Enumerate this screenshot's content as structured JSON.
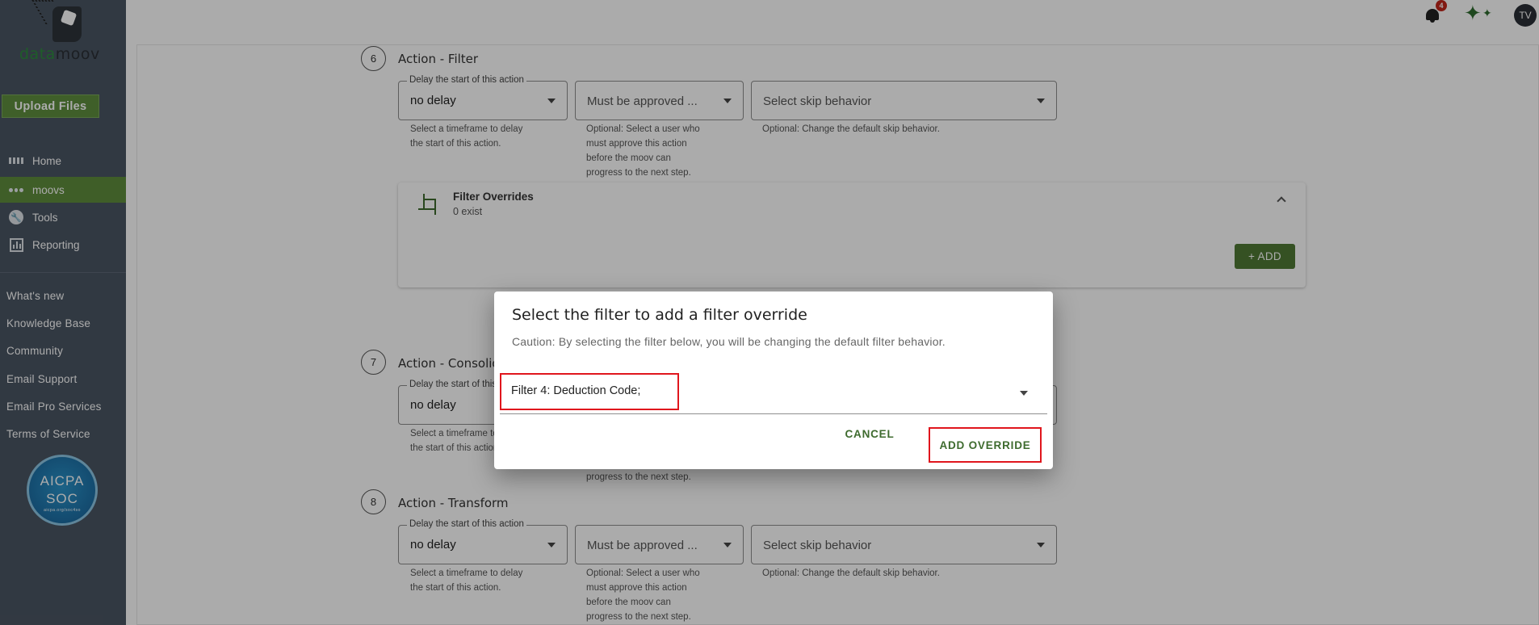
{
  "brand": {
    "logo_part1": "datamoov",
    "logo_green": "data",
    "logo_dark": "moov"
  },
  "sidebar": {
    "upload_label": "Upload Files",
    "nav": [
      {
        "label": "Home",
        "icon": "home-icon",
        "active": false
      },
      {
        "label": "moovs",
        "icon": "moovs-icon",
        "active": true
      },
      {
        "label": "Tools",
        "icon": "tools-icon",
        "active": false
      },
      {
        "label": "Reporting",
        "icon": "reporting-icon",
        "active": false
      }
    ],
    "links": [
      "What's new",
      "Knowledge Base",
      "Community",
      "Email Support",
      "Email Pro Services",
      "Terms of Service"
    ],
    "badge": {
      "line1": "AICPA",
      "line2": "SOC",
      "line3": "aicpa.org/soc4so"
    }
  },
  "topbar": {
    "notification_count": "4",
    "avatar_initials": "TV"
  },
  "steps": [
    {
      "number": "6",
      "title": "Action - Filter",
      "delay_legend": "Delay the start of this action",
      "delay_value": "no delay",
      "delay_help_1": "Select a timeframe to delay",
      "delay_help_2": "the start of this action.",
      "approve_placeholder": "Must be approved ...",
      "approve_help": [
        "Optional: Select a user who",
        "must approve this action",
        "before the moov can",
        "progress to the next step."
      ],
      "skip_placeholder": "Select skip behavior",
      "skip_help": "Optional: Change the default skip behavior."
    },
    {
      "number": "7",
      "title": "Action - Consolidate",
      "delay_legend": "Delay the start of this action",
      "delay_value": "no delay",
      "delay_help_1": "Select a timeframe to delay",
      "delay_help_2": "the start of this action.",
      "approve_help_last": "progress to the next step."
    },
    {
      "number": "8",
      "title": "Action - Transform",
      "delay_legend": "Delay the start of this action",
      "delay_value": "no delay",
      "delay_help_1": "Select a timeframe to delay",
      "delay_help_2": "the start of this action.",
      "approve_placeholder": "Must be approved ...",
      "approve_help": [
        "Optional: Select a user who",
        "must approve this action",
        "before the moov can",
        "progress to the next step."
      ],
      "skip_placeholder": "Select skip behavior",
      "skip_help": "Optional: Change the default skip behavior."
    }
  ],
  "filter_overrides": {
    "title": "Filter Overrides",
    "subtitle": "0 exist",
    "add_label": "+ ADD"
  },
  "dialog": {
    "title": "Select the filter to add a filter override",
    "caution": "Caution: By selecting the filter below, you will be changing the default filter behavior.",
    "selected_filter": "Filter 4: Deduction Code;",
    "cancel_label": "CANCEL",
    "add_label": "ADD OVERRIDE"
  },
  "colors": {
    "sidebar_bg": "#4a5563",
    "accent_green": "#5f8c3c",
    "button_green": "#4f7a35",
    "highlight_red": "#e0161d"
  }
}
